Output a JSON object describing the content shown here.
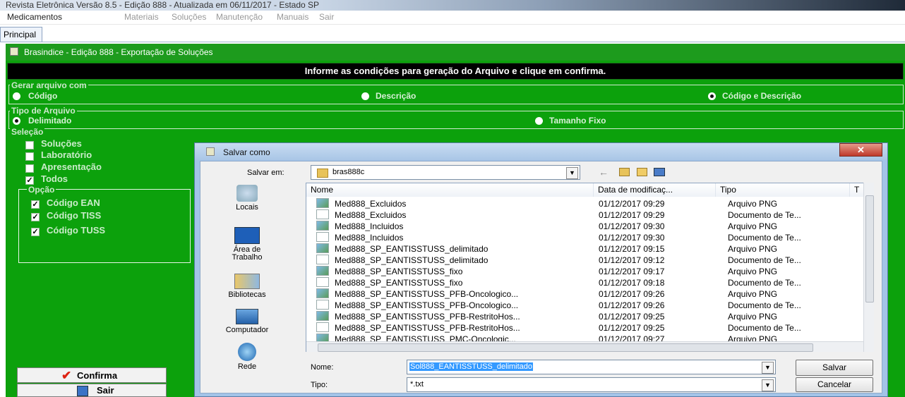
{
  "window": {
    "title": "Revista Eletrônica Versão 8.5 - Edição 888 - Atualizada em 06/11/2017 - Estado  SP",
    "menu": [
      "Medicamentos",
      "Materiais",
      "Soluções",
      "Manutenção",
      "Manuais",
      "Sair"
    ],
    "tab": "Principal"
  },
  "app": {
    "title": "Brasindice - Edição 888 - Exportação de Soluções",
    "banner": "Informe as condições para geração do Arquivo e clique em confirma.",
    "gerar": {
      "label": "Gerar arquivo com",
      "options": [
        "Código",
        "Descrição",
        "Código e Descrição"
      ],
      "selected": "Código e Descrição"
    },
    "tipo": {
      "label": "Tipo de Arquivo",
      "options": [
        "Delimitado",
        "Tamanho Fixo"
      ],
      "selected": "Delimitado"
    },
    "selecao": {
      "label": "Seleção",
      "items": [
        {
          "label": "Soluções",
          "checked": false
        },
        {
          "label": "Laboratório",
          "checked": false
        },
        {
          "label": "Apresentação",
          "checked": false
        },
        {
          "label": "Todos",
          "checked": true
        }
      ]
    },
    "opcao": {
      "label": "Opção",
      "items": [
        {
          "label": "Código EAN",
          "checked": true
        },
        {
          "label": "Código TISS",
          "checked": true
        },
        {
          "label": "Código TUSS",
          "checked": true
        }
      ]
    },
    "buttons": {
      "confirma": "Confirma",
      "sair": "Sair"
    }
  },
  "dialog": {
    "title": "Salvar como",
    "save_in_label": "Salvar em:",
    "save_in_value": "bras888c",
    "places": [
      "Locais",
      "Área de Trabalho",
      "Bibliotecas",
      "Computador",
      "Rede"
    ],
    "columns": [
      "Nome",
      "Data de modificaç...",
      "Tipo",
      "T"
    ],
    "files": [
      {
        "name": "Med888_Excluidos",
        "date": "01/12/2017 09:29",
        "type": "Arquivo PNG",
        "icon": "png"
      },
      {
        "name": "Med888_Excluidos",
        "date": "01/12/2017 09:29",
        "type": "Documento de Te...",
        "icon": "txt"
      },
      {
        "name": "Med888_Incluidos",
        "date": "01/12/2017 09:30",
        "type": "Arquivo PNG",
        "icon": "png"
      },
      {
        "name": "Med888_Incluidos",
        "date": "01/12/2017 09:30",
        "type": "Documento de Te...",
        "icon": "txt"
      },
      {
        "name": "Med888_SP_EANTISSTUSS_delimitado",
        "date": "01/12/2017 09:15",
        "type": "Arquivo PNG",
        "icon": "png"
      },
      {
        "name": "Med888_SP_EANTISSTUSS_delimitado",
        "date": "01/12/2017 09:12",
        "type": "Documento de Te...",
        "icon": "txt"
      },
      {
        "name": "Med888_SP_EANTISSTUSS_fixo",
        "date": "01/12/2017 09:17",
        "type": "Arquivo PNG",
        "icon": "png"
      },
      {
        "name": "Med888_SP_EANTISSTUSS_fixo",
        "date": "01/12/2017 09:18",
        "type": "Documento de Te...",
        "icon": "txt"
      },
      {
        "name": "Med888_SP_EANTISSTUSS_PFB-Oncologico...",
        "date": "01/12/2017 09:26",
        "type": "Arquivo PNG",
        "icon": "png"
      },
      {
        "name": "Med888_SP_EANTISSTUSS_PFB-Oncologico...",
        "date": "01/12/2017 09:26",
        "type": "Documento de Te...",
        "icon": "txt"
      },
      {
        "name": "Med888_SP_EANTISSTUSS_PFB-RestritoHos...",
        "date": "01/12/2017 09:25",
        "type": "Arquivo PNG",
        "icon": "png"
      },
      {
        "name": "Med888_SP_EANTISSTUSS_PFB-RestritoHos...",
        "date": "01/12/2017 09:25",
        "type": "Documento de Te...",
        "icon": "txt"
      },
      {
        "name": "Med888_SP_EANTISSTUSS_PMC-Oncologic...",
        "date": "01/12/2017 09:27",
        "type": "Arquivo PNG",
        "icon": "png"
      }
    ],
    "name_label": "Nome:",
    "name_value": "Sol888_EANTISSTUSS_delimitado",
    "type_label": "Tipo:",
    "type_value": "*.txt",
    "save_button": "Salvar",
    "cancel_button": "Cancelar"
  }
}
